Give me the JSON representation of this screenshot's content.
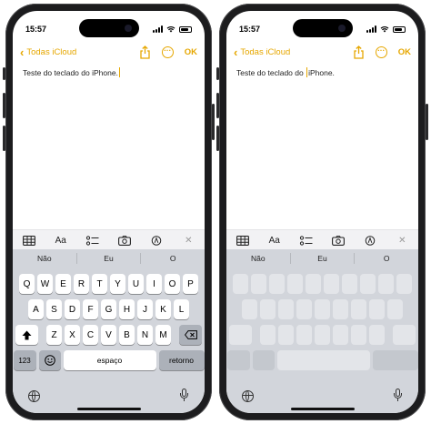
{
  "phones": [
    {
      "status": {
        "time": "15:57"
      },
      "nav": {
        "back_label": "Todas iCloud",
        "ok_label": "OK"
      },
      "note": {
        "text": "Teste do teclado do iPhone."
      },
      "toolbar": {
        "format_label": "Aa"
      },
      "suggestions": [
        "Não",
        "Eu",
        "O"
      ],
      "keyboard": {
        "row1": [
          "Q",
          "W",
          "E",
          "R",
          "T",
          "Y",
          "U",
          "I",
          "O",
          "P"
        ],
        "row2": [
          "A",
          "S",
          "D",
          "F",
          "G",
          "H",
          "J",
          "K",
          "L"
        ],
        "row3": [
          "Z",
          "X",
          "C",
          "V",
          "B",
          "N",
          "M"
        ],
        "numbers_label": "123",
        "space_label": "espaço",
        "return_label": "retorno"
      }
    },
    {
      "status": {
        "time": "15:57"
      },
      "nav": {
        "back_label": "Todas iCloud",
        "ok_label": "OK"
      },
      "note": {
        "text_before_cursor": "Teste do teclado do ",
        "text_after_cursor": "iPhone."
      },
      "toolbar": {
        "format_label": "Aa"
      },
      "suggestions": [
        "Não",
        "Eu",
        "O"
      ],
      "keyboard_state": "trackpad"
    }
  ],
  "colors": {
    "accent": "#e6a700",
    "keyboard_bg": "#d2d5db"
  },
  "icons": [
    "signal-icon",
    "wifi-icon",
    "battery-icon",
    "back-chevron-icon",
    "share-icon",
    "more-icon",
    "table-icon",
    "checklist-icon",
    "camera-icon",
    "markup-icon",
    "close-icon",
    "shift-icon",
    "delete-icon",
    "emoji-icon",
    "globe-icon",
    "mic-icon"
  ]
}
